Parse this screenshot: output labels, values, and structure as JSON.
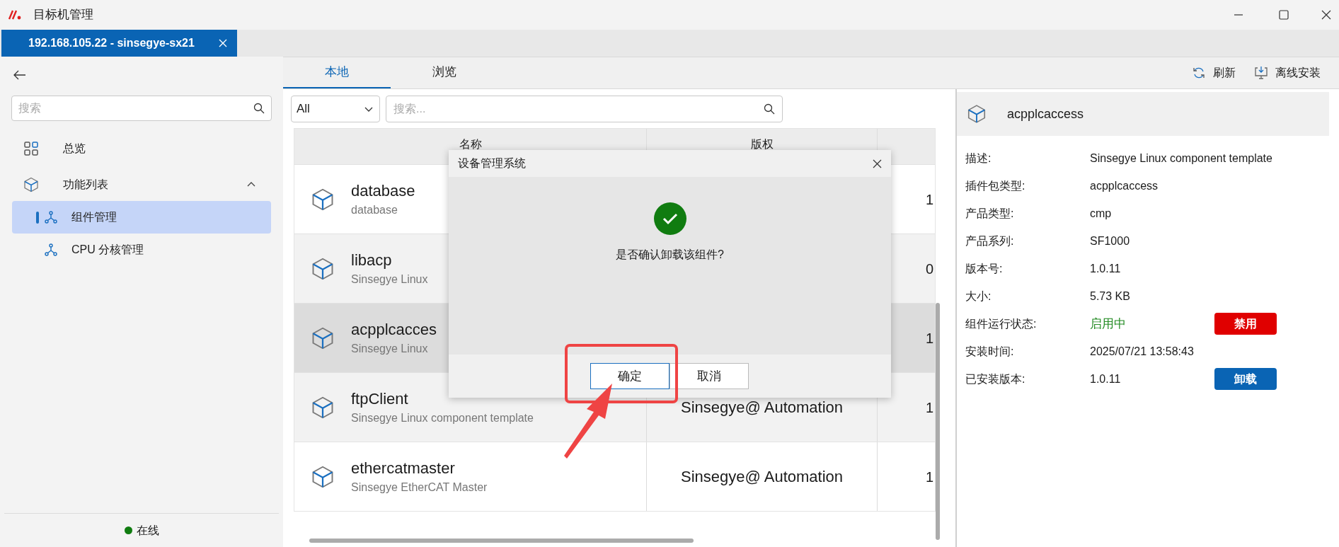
{
  "window": {
    "title": "目标机管理"
  },
  "session_tab": {
    "label": "192.168.105.22  -  sinsegye-sx21",
    "selected": true
  },
  "sidebar": {
    "search_placeholder": "搜索",
    "items": [
      {
        "label": "总览",
        "kind": "grid",
        "selected": false
      },
      {
        "label": "功能列表",
        "kind": "cube",
        "selected": false,
        "expanded": true,
        "children": [
          {
            "label": "组件管理",
            "kind": "nodes",
            "selected": true
          },
          {
            "label": "CPU  分核管理",
            "kind": "nodes",
            "selected": false
          }
        ]
      }
    ],
    "status": {
      "label": "在线",
      "color": "#107c10"
    }
  },
  "view_tabs": [
    {
      "label": "本地",
      "selected": true
    },
    {
      "label": "浏览",
      "selected": false
    }
  ],
  "toolbar": [
    {
      "label": "刷新",
      "kind": "refresh"
    },
    {
      "label": "离线安装",
      "kind": "install"
    }
  ],
  "filter": {
    "value": "All",
    "search_placeholder": "搜索..."
  },
  "table": {
    "columns": [
      "名称",
      "版权"
    ],
    "rows": [
      {
        "name": "database",
        "subtitle": "database",
        "version": "1",
        "selected": false
      },
      {
        "name": "libacp",
        "subtitle": "Sinsegye  Linux",
        "version": "0",
        "selected": false
      },
      {
        "name": "acpplcacces",
        "subtitle": "Sinsegye  Linux",
        "version": "1",
        "selected": true
      },
      {
        "name": "ftpClient",
        "subtitle": "Sinsegye  Linux  component  template",
        "copyright": "Sinsegye@  Automation",
        "version": "1",
        "selected": false
      },
      {
        "name": "ethercatmaster",
        "subtitle": "Sinsegye  EtherCAT  Master",
        "copyright": "Sinsegye@  Automation",
        "version": "1",
        "selected": false
      }
    ]
  },
  "details": {
    "title": "acpplcaccess",
    "fields": [
      {
        "label": "描述:",
        "value": "Sinsegye  Linux  component  template"
      },
      {
        "label": "插件包类型:",
        "value": "acpplcaccess"
      },
      {
        "label": "产品类型:",
        "value": "cmp"
      },
      {
        "label": "产品系列:",
        "value": "SF1000"
      },
      {
        "label": "版本号:",
        "value": "1.0.11"
      },
      {
        "label": "大小:",
        "value": "5.73  KB"
      },
      {
        "label": "组件运行状态:",
        "value": "启用中",
        "kind": "status",
        "action": {
          "label": "禁用",
          "color": "#e00000"
        }
      },
      {
        "label": "安装时间:",
        "value": "2025/07/21  13:58:43"
      },
      {
        "label": "已安装版本:",
        "value": "1.0.11",
        "action": {
          "label": "卸载",
          "color": "#0a64b4"
        }
      }
    ]
  },
  "dialog": {
    "title": "设备管理系统",
    "message": "是否确认卸载该组件?",
    "buttons": [
      {
        "label": "确定",
        "selected": true
      },
      {
        "label": "取消",
        "selected": false
      }
    ]
  }
}
